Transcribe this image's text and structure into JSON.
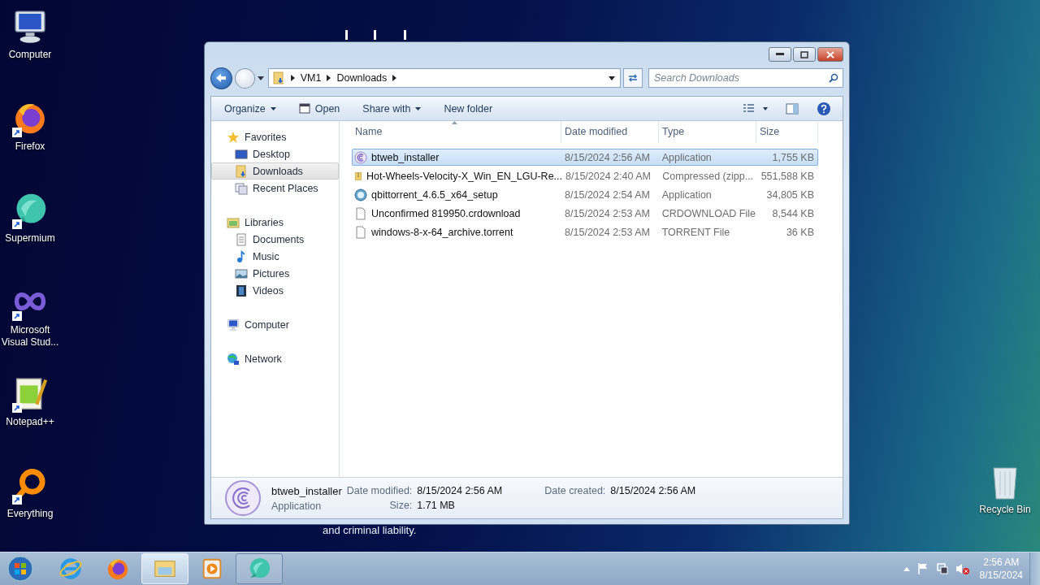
{
  "desktop_icons": [
    {
      "label": "Computer",
      "kind": "computer",
      "shortcut": false
    },
    {
      "label": "Firefox",
      "kind": "firefox",
      "shortcut": true
    },
    {
      "label": "Supermium",
      "kind": "supermium",
      "shortcut": true
    },
    {
      "label": "Microsoft Visual Stud...",
      "kind": "infinity",
      "shortcut": true
    },
    {
      "label": "Notepad++",
      "kind": "notepad",
      "shortcut": true
    },
    {
      "label": "Everything",
      "kind": "everything",
      "shortcut": true
    }
  ],
  "recycle_bin": {
    "label": "Recycle Bin"
  },
  "background_text": "and criminal liability.",
  "window": {
    "address": {
      "breadcrumb": [
        "VM1",
        "Downloads"
      ],
      "search_placeholder": "Search Downloads"
    },
    "toolbar": [
      {
        "label": "Organize",
        "dropdown": true,
        "kind": "text"
      },
      {
        "label": "Open",
        "dropdown": false,
        "kind": "open"
      },
      {
        "label": "Share with",
        "dropdown": true,
        "kind": "text"
      },
      {
        "label": "New folder",
        "dropdown": false,
        "kind": "text"
      }
    ],
    "nav_pane": [
      {
        "label": "Favorites",
        "kind": "star",
        "selected": false,
        "children": [
          {
            "label": "Desktop",
            "kind": "desktop",
            "selected": false
          },
          {
            "label": "Downloads",
            "kind": "downloads",
            "selected": true
          },
          {
            "label": "Recent Places",
            "kind": "recent",
            "selected": false
          }
        ]
      },
      {
        "label": "Libraries",
        "kind": "libraries",
        "selected": false,
        "children": [
          {
            "label": "Documents",
            "kind": "documents",
            "selected": false
          },
          {
            "label": "Music",
            "kind": "music",
            "selected": false
          },
          {
            "label": "Pictures",
            "kind": "pictures",
            "selected": false
          },
          {
            "label": "Videos",
            "kind": "videos",
            "selected": false
          }
        ]
      },
      {
        "label": "Computer",
        "kind": "computer",
        "selected": false
      },
      {
        "label": "Network",
        "kind": "network",
        "selected": false
      }
    ],
    "columns": [
      "Name",
      "Date modified",
      "Type",
      "Size"
    ],
    "rows": [
      {
        "kind": "bt-app",
        "name": "btweb_installer",
        "date": "8/15/2024 2:56 AM",
        "type": "Application",
        "size": "1,755 KB",
        "selected": true
      },
      {
        "kind": "archive",
        "name": "Hot-Wheels-Velocity-X_Win_EN_LGU-Re...",
        "date": "8/15/2024 2:40 AM",
        "type": "Compressed (zipp...",
        "size": "551,588 KB",
        "selected": false
      },
      {
        "kind": "qb-app",
        "name": "qbittorrent_4.6.5_x64_setup",
        "date": "8/15/2024 2:54 AM",
        "type": "Application",
        "size": "34,805 KB",
        "selected": false
      },
      {
        "kind": "blank-file",
        "name": "Unconfirmed 819950.crdownload",
        "date": "8/15/2024 2:53 AM",
        "type": "CRDOWNLOAD File",
        "size": "8,544 KB",
        "selected": false
      },
      {
        "kind": "blank-file",
        "name": "windows-8-x-64_archive.torrent",
        "date": "8/15/2024 2:53 AM",
        "type": "TORRENT File",
        "size": "36 KB",
        "selected": false
      }
    ],
    "details": {
      "name": "btweb_installer",
      "type": "Application",
      "fields": [
        {
          "label": "Date modified:",
          "value": "8/15/2024 2:56 AM"
        },
        {
          "label": "Date created:",
          "value": "8/15/2024 2:56 AM"
        },
        {
          "label": "Size:",
          "value": "1.71 MB"
        }
      ]
    }
  },
  "taskbar": {
    "items": [
      {
        "kind": "ie",
        "active": false,
        "running": false
      },
      {
        "kind": "firefox",
        "active": false,
        "running": false
      },
      {
        "kind": "explorer",
        "active": true,
        "running": true
      },
      {
        "kind": "media",
        "active": false,
        "running": false
      },
      {
        "kind": "supermium",
        "active": false,
        "running": true
      }
    ],
    "time": "2:56 AM",
    "date": "8/15/2024"
  }
}
